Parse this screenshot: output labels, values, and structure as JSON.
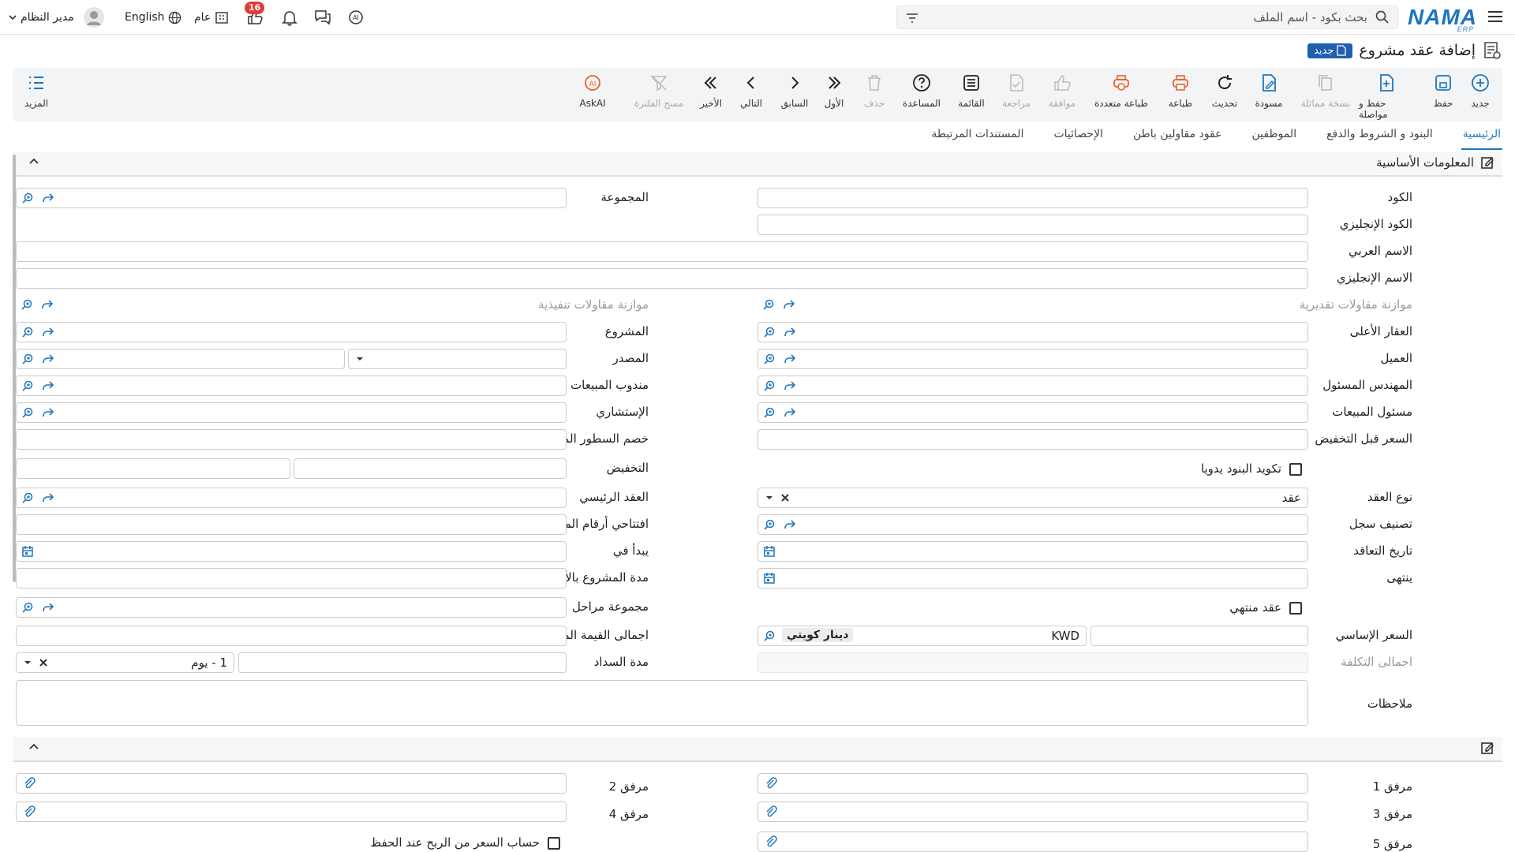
{
  "header": {
    "logo": "NAMA",
    "logo_sub": "ERP",
    "search_placeholder": "بحث بكود - اسم الملف",
    "user_name": "مدير النظام",
    "language": "English",
    "company": "عام",
    "notif_count": "16"
  },
  "page": {
    "title": "إضافة عقد مشروع",
    "badge": "جديد"
  },
  "toolbar": {
    "new": "جديد",
    "save": "حفظ",
    "save_continue": "حفظ و مواصلة",
    "duplicate": "نسخة مماثلة",
    "draft": "مسودة",
    "refresh": "تحديث",
    "print": "طباعة",
    "multi_print": "طباعة متعددة",
    "approve": "موافقة",
    "review": "مراجعة",
    "list": "القائمة",
    "help": "المساعدة",
    "delete": "حذف",
    "first": "الأول",
    "previous": "السابق",
    "next": "التالي",
    "last": "الأخير",
    "clear_filter": "مسح الفلترة",
    "askai": "AskAI",
    "more": "المزيد"
  },
  "tabs": [
    "الرئيسية",
    "البنود و الشروط والدفع",
    "الموظفين",
    "عقود مقاولين باطن",
    "الإحصائيات",
    "المستندات المرتبطة"
  ],
  "section1": {
    "title": "المعلومات الأساسية"
  },
  "labels": {
    "code": "الكود",
    "english_code": "الكود الإنجليزي",
    "arabic_name": "الاسم العربي",
    "english_name": "الاسم الإنجليزي",
    "estimated_budget": "موازنة مقاولات تقديرية",
    "parent_property": "العقار الأعلى",
    "customer": "العميل",
    "engineer": "المهندس المسئول",
    "sales_officer": "مسئول المبيعات",
    "price_before_discount": "السعر قبل التخفيض",
    "manual_items": "تكويد البنود يدويا",
    "contract_type": "نوع العقد",
    "record_class": "تصنيف سجل",
    "contract_date": "تاريخ التعاقد",
    "ends": "ينتهى",
    "ended_contract": "عقد منتهي",
    "base_price": "السعر الإساسي",
    "total_cost": "اجمالى التكلفة",
    "notes": "ملاحظات",
    "group": "المجموعة",
    "exec_budget": "موازنة مقاولات تنفيذية",
    "project": "المشروع",
    "source": "المصدر",
    "sales_rep": "مندوب المبيعات",
    "consultant": "الإستشاري",
    "unified_discount": "خصم السطور الموحد",
    "discount": "التخفيض",
    "main_contract": "العقد الرئيسي",
    "extract_numbers": "افتتاحي أرقام المستخلصات",
    "starts_at": "يبدأ في",
    "duration_days": "مدة المشروع بالأيام",
    "phases_group": "مجموعة مراحل",
    "total_due": "اجمالى القيمة المستحقة",
    "payment_period": "مدة السداد",
    "att1": "مرفق 1",
    "att2": "مرفق 2",
    "att3": "مرفق 3",
    "att4": "مرفق 4",
    "att5": "مرفق 5",
    "calc_price": "حساب السعر من الربح عند الحفظ"
  },
  "values": {
    "contract_type": "عقد",
    "currency_code": "KWD",
    "currency_name": "دينار كويتي",
    "payment_period": "1 - يوم"
  }
}
